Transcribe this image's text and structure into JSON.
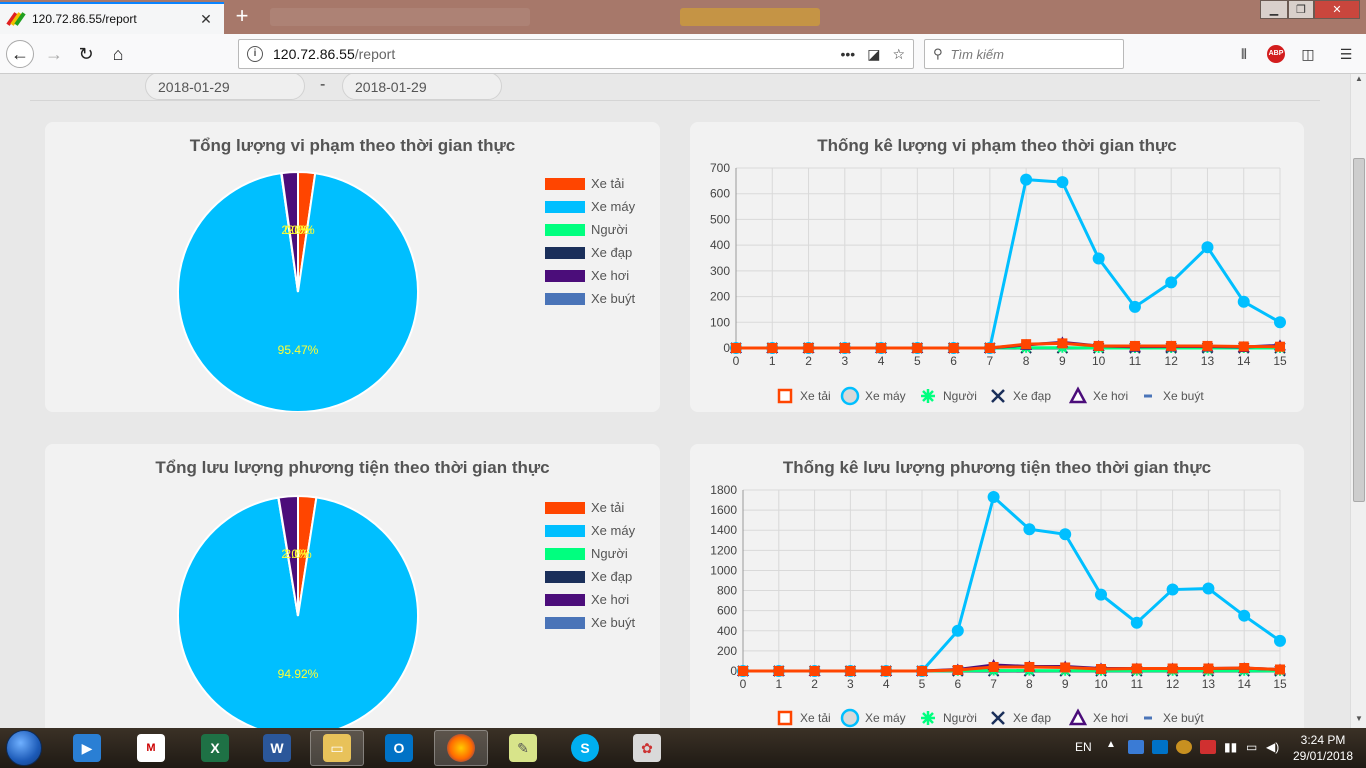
{
  "browser": {
    "tab_title": "120.72.86.55/report",
    "url_host": "120.72.86.55",
    "url_path": "/report",
    "search_placeholder": "Tìm kiếm"
  },
  "filters": {
    "date_from": "2018-01-29",
    "separator": "-",
    "date_to": "2018-01-29"
  },
  "legend_labels": [
    "Xe tải",
    "Xe máy",
    "Người",
    "Xe đạp",
    "Xe hơi",
    "Xe buýt"
  ],
  "colors": {
    "xe_tai": "#ff4500",
    "xe_may": "#00bfff",
    "nguoi": "#00ff7f",
    "xe_dap": "#1a2f5a",
    "xe_hoi": "#4b0d7a",
    "xe_buyt": "#4a74b8"
  },
  "cards": {
    "pie1_title": "Tổng lượng vi phạm theo thời gian thực",
    "line1_title": "Thống kê lượng vi phạm theo thời gian thực",
    "pie2_title": "Tổng lưu lượng phương tiện theo thời gian thực",
    "line2_title": "Thống kê lưu lượng phương tiện theo thời gian thực"
  },
  "chart_data": [
    {
      "type": "pie",
      "title": "Tổng lượng vi phạm theo thời gian thực",
      "labels": [
        "Xe tải",
        "Xe máy",
        "Người",
        "Xe đạp",
        "Xe hơi",
        "Xe buýt"
      ],
      "values": [
        2.29,
        95.47,
        0.07,
        0.0,
        2.17,
        0.0
      ],
      "data_labels": [
        "95.47%",
        "2.0%",
        "0.0%",
        "2.0%"
      ],
      "legend": "right"
    },
    {
      "type": "line",
      "title": "Thống kê lượng vi phạm theo thời gian thực",
      "x": [
        0,
        1,
        2,
        3,
        4,
        5,
        6,
        7,
        8,
        9,
        10,
        11,
        12,
        13,
        14,
        15
      ],
      "ylim": [
        0,
        700
      ],
      "yticks": [
        0,
        100,
        200,
        300,
        400,
        500,
        600,
        700
      ],
      "grid": true,
      "legend": "bottom",
      "series": [
        {
          "name": "Xe tải",
          "values": [
            0,
            0,
            0,
            0,
            0,
            0,
            0,
            0,
            15,
            18,
            8,
            8,
            8,
            8,
            6,
            5
          ]
        },
        {
          "name": "Xe máy",
          "values": [
            0,
            0,
            0,
            0,
            0,
            0,
            0,
            0,
            655,
            645,
            348,
            160,
            255,
            392,
            180,
            100
          ]
        },
        {
          "name": "Người",
          "values": [
            0,
            0,
            0,
            0,
            0,
            0,
            0,
            0,
            1,
            1,
            0,
            0,
            0,
            0,
            0,
            0
          ]
        },
        {
          "name": "Xe đạp",
          "values": [
            0,
            0,
            0,
            0,
            0,
            0,
            0,
            0,
            0,
            0,
            0,
            0,
            0,
            0,
            0,
            0
          ]
        },
        {
          "name": "Xe hơi",
          "values": [
            0,
            0,
            0,
            0,
            0,
            0,
            0,
            0,
            12,
            22,
            8,
            5,
            6,
            6,
            4,
            10
          ]
        },
        {
          "name": "Xe buýt",
          "values": [
            0,
            0,
            0,
            0,
            0,
            0,
            0,
            0,
            0,
            0,
            0,
            0,
            0,
            0,
            0,
            0
          ]
        }
      ]
    },
    {
      "type": "pie",
      "title": "Tổng lưu lượng phương tiện theo thời gian thực",
      "labels": [
        "Xe tải",
        "Xe máy",
        "Người",
        "Xe đạp",
        "Xe hơi",
        "Xe buýt"
      ],
      "values": [
        2.45,
        94.92,
        0.05,
        0.0,
        2.58,
        0.0
      ],
      "data_labels": [
        "94.92%",
        "2.0%",
        "2.0%"
      ],
      "legend": "right"
    },
    {
      "type": "line",
      "title": "Thống kê lưu lượng phương tiện theo thời gian thực",
      "x": [
        0,
        1,
        2,
        3,
        4,
        5,
        6,
        7,
        8,
        9,
        10,
        11,
        12,
        13,
        14,
        15
      ],
      "ylim": [
        0,
        1800
      ],
      "yticks": [
        0,
        200,
        400,
        600,
        800,
        1000,
        1200,
        1400,
        1600,
        1800
      ],
      "grid": true,
      "legend": "bottom",
      "series": [
        {
          "name": "Xe tải",
          "values": [
            0,
            0,
            0,
            0,
            0,
            0,
            10,
            40,
            40,
            35,
            20,
            25,
            25,
            25,
            30,
            15
          ]
        },
        {
          "name": "Xe máy",
          "values": [
            0,
            0,
            0,
            0,
            0,
            0,
            400,
            1730,
            1410,
            1360,
            760,
            480,
            810,
            820,
            550,
            300
          ]
        },
        {
          "name": "Người",
          "values": [
            0,
            0,
            0,
            0,
            0,
            0,
            2,
            5,
            4,
            3,
            2,
            2,
            2,
            2,
            2,
            1
          ]
        },
        {
          "name": "Xe đạp",
          "values": [
            0,
            0,
            0,
            0,
            0,
            0,
            0,
            0,
            0,
            0,
            0,
            0,
            0,
            0,
            0,
            0
          ]
        },
        {
          "name": "Xe hơi",
          "values": [
            0,
            0,
            0,
            0,
            0,
            0,
            15,
            60,
            45,
            45,
            25,
            25,
            25,
            25,
            28,
            15
          ]
        },
        {
          "name": "Xe buýt",
          "values": [
            0,
            0,
            0,
            0,
            0,
            0,
            0,
            0,
            0,
            0,
            0,
            0,
            0,
            0,
            0,
            0
          ]
        }
      ]
    }
  ],
  "taskbar": {
    "language": "EN",
    "time": "3:24 PM",
    "date": "29/01/2018",
    "apps": [
      "media-player",
      "paint-app",
      "excel",
      "word",
      "file-explorer",
      "firefox",
      "notes",
      "skype",
      "paint"
    ]
  }
}
